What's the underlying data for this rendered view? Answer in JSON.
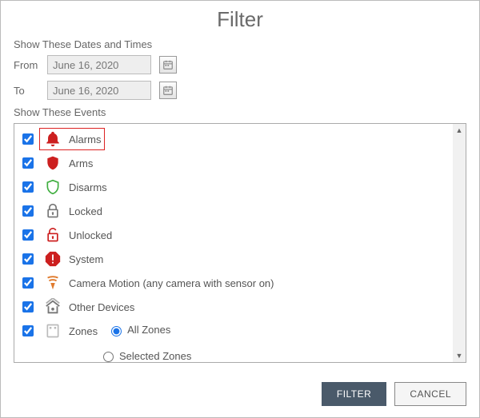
{
  "title": "Filter",
  "dates_section_label": "Show These Dates and Times",
  "from_label": "From",
  "to_label": "To",
  "from_value": "June 16, 2020",
  "to_value": "June 16, 2020",
  "events_section_label": "Show These Events",
  "events": {
    "alarms": {
      "label": "Alarms",
      "checked": true,
      "highlighted": true
    },
    "arms": {
      "label": "Arms",
      "checked": true
    },
    "disarms": {
      "label": "Disarms",
      "checked": true
    },
    "locked": {
      "label": "Locked",
      "checked": true
    },
    "unlocked": {
      "label": "Unlocked",
      "checked": true
    },
    "system": {
      "label": "System",
      "checked": true
    },
    "camera_motion": {
      "label": "Camera Motion (any camera with sensor on)",
      "checked": true
    },
    "other_devices": {
      "label": "Other Devices",
      "checked": true
    },
    "zones": {
      "label": "Zones",
      "checked": true
    }
  },
  "zone_options": {
    "all_zones_label": "All Zones",
    "selected_zones_label": "Selected Zones",
    "selected": "all"
  },
  "buttons": {
    "filter": "FILTER",
    "cancel": "CANCEL"
  }
}
